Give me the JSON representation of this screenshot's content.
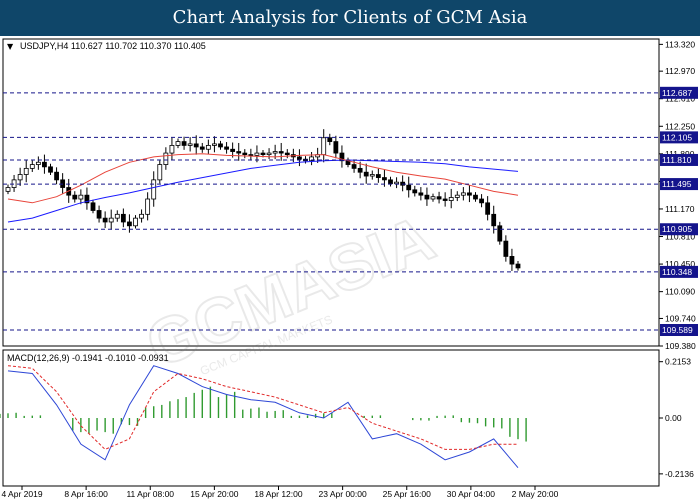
{
  "header": {
    "title": "Chart Analysis for Clients of GCM Asia"
  },
  "watermark": {
    "main_text": "GCMASIA",
    "sub_text": "GCM CAPITAL MARKETS"
  },
  "chart_data": [
    {
      "type": "candlestick",
      "header_text": "USDJPY,H4  110.627 110.702 110.370 110.405",
      "symbol": "USDJPY",
      "timeframe": "H4",
      "ohlc_readout": {
        "open": 110.627,
        "high": 110.702,
        "low": 110.37,
        "close": 110.405
      },
      "y_ticks": [
        109.38,
        109.74,
        110.09,
        110.45,
        110.81,
        111.17,
        111.53,
        111.89,
        112.25,
        112.61,
        112.97,
        113.32
      ],
      "ylim": [
        109.38,
        113.39
      ],
      "x_labels": [
        "4 Apr 2019",
        "8 Apr 16:00",
        "11 Apr 08:00",
        "15 Apr 20:00",
        "18 Apr 12:00",
        "23 Apr 00:00",
        "25 Apr 16:00",
        "30 Apr 04:00",
        "2 May 20:00"
      ],
      "levels": [
        {
          "value": 112.687,
          "label": "112.687"
        },
        {
          "value": 112.105,
          "label": "112.105"
        },
        {
          "value": 111.81,
          "label": "111.810"
        },
        {
          "value": 111.495,
          "label": "111.495"
        },
        {
          "value": 110.905,
          "label": "110.905"
        },
        {
          "value": 110.348,
          "label": "110.348"
        },
        {
          "value": 109.589,
          "label": "109.589"
        }
      ],
      "series": [
        {
          "type": "ohlc",
          "close": [
            111.45,
            111.55,
            111.62,
            111.7,
            111.75,
            111.78,
            111.72,
            111.65,
            111.55,
            111.45,
            111.35,
            111.3,
            111.35,
            111.25,
            111.15,
            111.05,
            111.0,
            111.05,
            111.1,
            111.0,
            110.95,
            111.05,
            111.1,
            111.3,
            111.55,
            111.75,
            111.9,
            112.0,
            112.05,
            112.0,
            112.02,
            111.98,
            111.95,
            112.0,
            112.02,
            111.98,
            111.95,
            111.92,
            111.9,
            111.88,
            111.87,
            111.9,
            111.88,
            111.9,
            111.92,
            111.9,
            111.88,
            111.85,
            111.82,
            111.8,
            111.85,
            111.88,
            112.1,
            112.05,
            111.9,
            111.8,
            111.75,
            111.7,
            111.65,
            111.6,
            111.62,
            111.58,
            111.55,
            111.5,
            111.52,
            111.48,
            111.42,
            111.38,
            111.35,
            111.3,
            111.33,
            111.3,
            111.28,
            111.32,
            111.35,
            111.38,
            111.35,
            111.3,
            111.25,
            111.1,
            110.95,
            110.75,
            110.55,
            110.45,
            110.4
          ]
        },
        {
          "type": "ma",
          "name": "",
          "color": "#1a1aff",
          "values": [
            111.0,
            111.05,
            111.15,
            111.25,
            111.32,
            111.38,
            111.45,
            111.52,
            111.58,
            111.64,
            111.7,
            111.74,
            111.78,
            111.8,
            111.81,
            111.8,
            111.79,
            111.78,
            111.76,
            111.72,
            111.69,
            111.66
          ]
        },
        {
          "type": "ma",
          "name": "",
          "color": "#e8443a",
          "values": [
            111.3,
            111.25,
            111.33,
            111.48,
            111.65,
            111.78,
            111.85,
            111.88,
            111.89,
            111.87,
            111.86,
            111.85,
            111.87,
            111.88,
            111.8,
            111.72,
            111.65,
            111.6,
            111.56,
            111.48,
            111.4,
            111.35
          ]
        }
      ]
    },
    {
      "type": "macd",
      "header_text": "MACD(12,26,9) -0.1941 -0.1010 -0.0931",
      "params": [
        12,
        26,
        9
      ],
      "values_readout": [
        -0.1941,
        -0.101,
        -0.0931
      ],
      "y_ticks": [
        0.2153,
        0.0,
        -0.2136
      ],
      "ylim": [
        -0.26,
        0.26
      ],
      "series": [
        {
          "type": "line",
          "name": "",
          "color": "#2e47d6",
          "values": [
            0.18,
            0.17,
            0.05,
            -0.1,
            -0.16,
            0.05,
            0.2,
            0.17,
            0.12,
            0.09,
            0.07,
            0.06,
            0.02,
            0.0,
            0.06,
            -0.08,
            -0.06,
            -0.1,
            -0.16,
            -0.13,
            -0.08,
            -0.19
          ]
        },
        {
          "type": "line",
          "name": "",
          "color": "#e12a2a",
          "values": [
            0.2,
            0.19,
            0.1,
            -0.03,
            -0.12,
            -0.08,
            0.1,
            0.17,
            0.15,
            0.12,
            0.1,
            0.08,
            0.05,
            0.02,
            0.04,
            -0.02,
            -0.05,
            -0.08,
            -0.12,
            -0.12,
            -0.1,
            -0.1
          ]
        },
        {
          "type": "histogram",
          "name": "",
          "color": "#2f9a2f",
          "values": [
            0.02,
            0.01,
            0.0,
            -0.06,
            -0.06,
            -0.03,
            0.05,
            0.08,
            0.12,
            0.1,
            0.04,
            0.03,
            0.01,
            0.02,
            0.0,
            0.01,
            0.0,
            -0.01,
            0.01,
            -0.02,
            -0.04,
            -0.09
          ]
        }
      ]
    }
  ]
}
